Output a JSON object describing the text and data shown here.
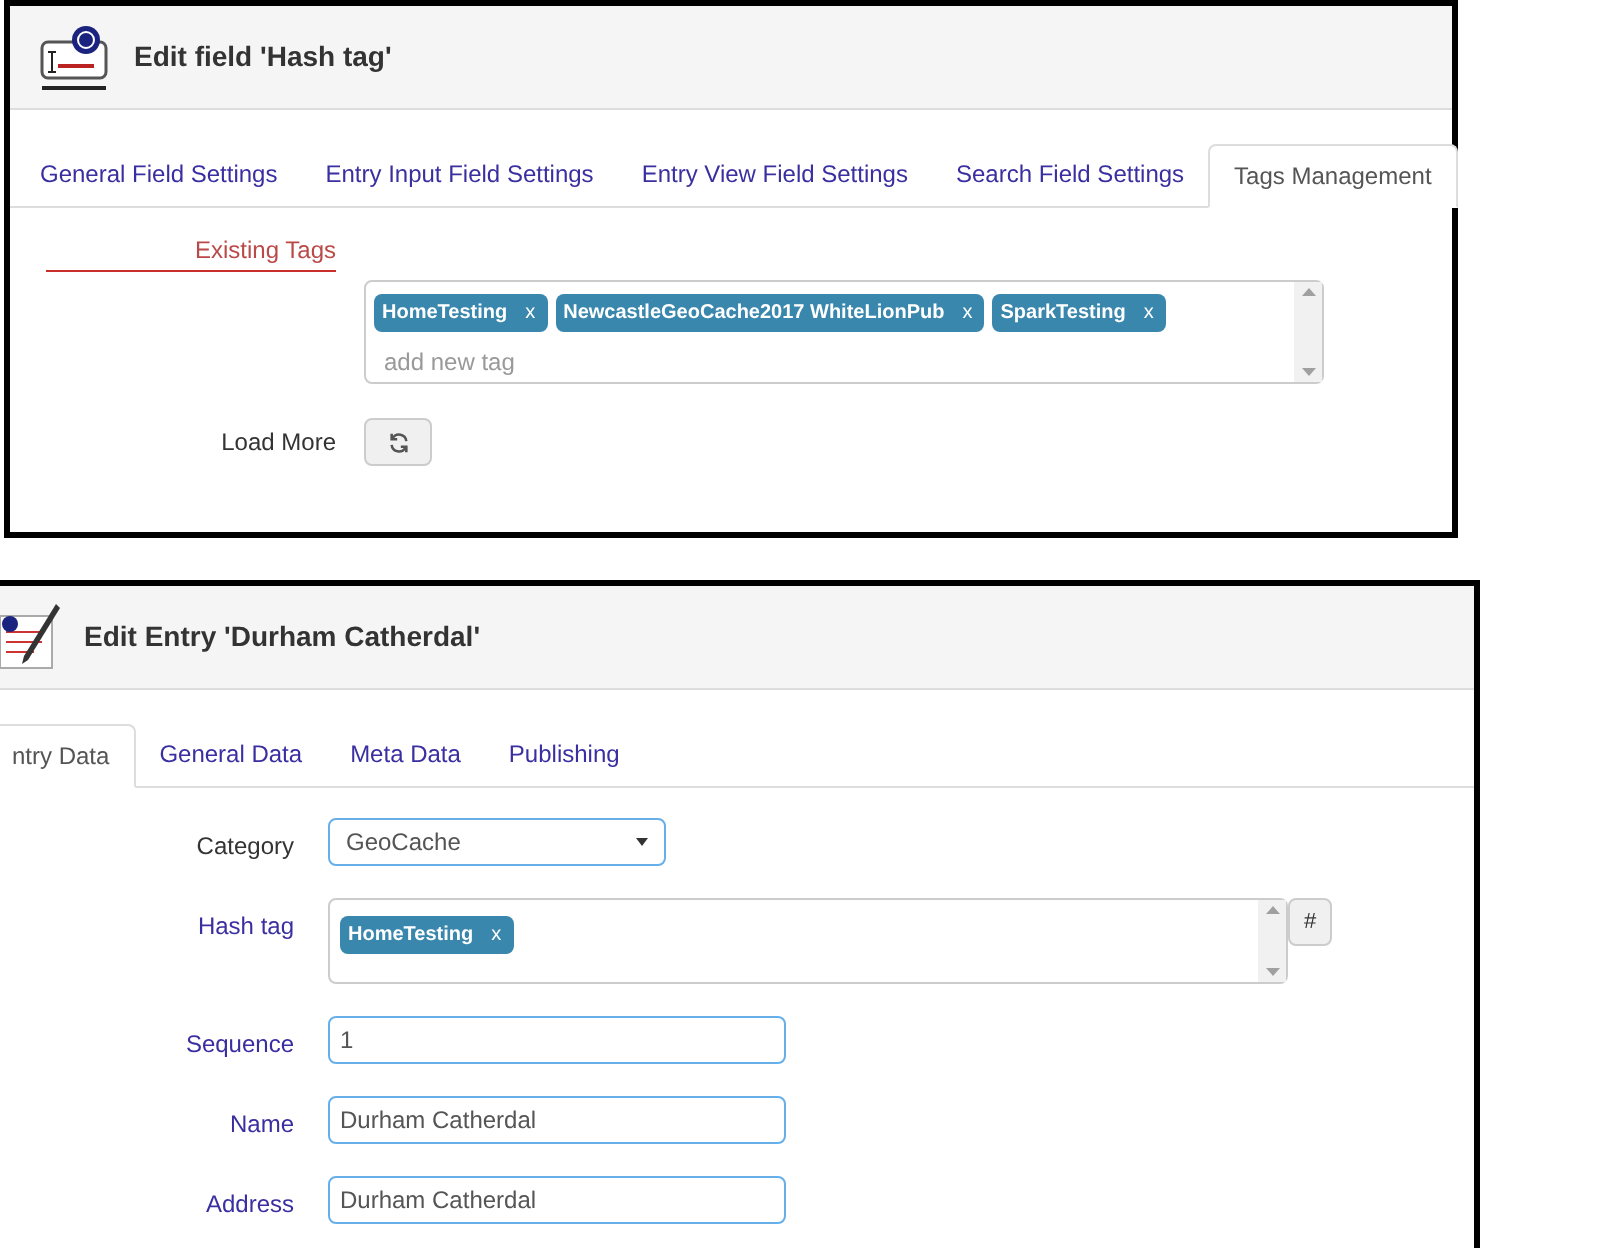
{
  "field_panel": {
    "title": "Edit field 'Hash tag'",
    "tabs": [
      {
        "label": "General Field Settings",
        "selected": false
      },
      {
        "label": "Entry Input Field Settings",
        "selected": false
      },
      {
        "label": "Entry View Field Settings",
        "selected": false
      },
      {
        "label": "Search Field Settings",
        "selected": false
      },
      {
        "label": "Tags Management",
        "selected": true
      }
    ],
    "existing_tags": {
      "label": "Existing Tags",
      "tags": [
        {
          "text": "HomeTesting",
          "remove": "x"
        },
        {
          "text": "NewcastleGeoCache2017 WhiteLionPub",
          "remove": "x"
        },
        {
          "text": "SparkTesting",
          "remove": "x"
        }
      ],
      "placeholder": "add new tag"
    },
    "load_more": {
      "label": "Load More"
    }
  },
  "entry_panel": {
    "title": "Edit Entry 'Durham Catherdal'",
    "tabs": [
      {
        "label": "ntry Data",
        "selected": true
      },
      {
        "label": "General Data",
        "selected": false
      },
      {
        "label": "Meta Data",
        "selected": false
      },
      {
        "label": "Publishing",
        "selected": false
      }
    ],
    "fields": [
      {
        "kind": "select",
        "label": "Category",
        "value": "GeoCache"
      },
      {
        "kind": "tags",
        "label": "Hash tag",
        "tags": [
          {
            "text": "HomeTesting",
            "remove": "x"
          }
        ],
        "button": "#"
      },
      {
        "kind": "text",
        "label": "Sequence",
        "value": "1"
      },
      {
        "kind": "text",
        "label": "Name",
        "value": "Durham Catherdal"
      },
      {
        "kind": "text",
        "label": "Address",
        "value": "Durham Catherdal"
      }
    ]
  }
}
